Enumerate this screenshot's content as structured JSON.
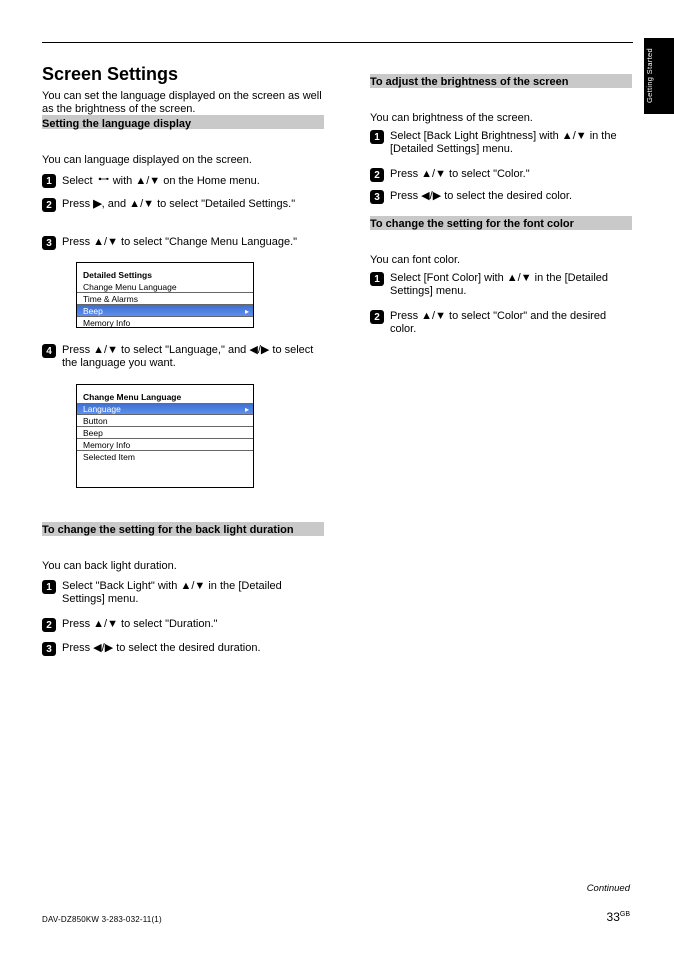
{
  "sidebar_label": "Getting Started",
  "h2_screen": "Screen Settings",
  "p_screen": "You can set the language displayed on the screen as well as the brightness of the screen.",
  "bar_lang": "Setting the language display",
  "p_lang": "You can language displayed on the screen.",
  "steps_lang": {
    "s1": {
      "pre": "Select ",
      "icon": "wrench",
      "post": " with ▲/▼ on the Home menu."
    },
    "s2": {
      "pre": "Press ",
      "b": "▶",
      "post": ", and ▲/▼ to select \"Detailed Settings.\""
    },
    "s3": "Press ▲/▼ to select \"Change Menu Language.\"",
    "s4": "Press ▲/▼ to select \"Language,\" and ◀/▶ to select the language you want."
  },
  "menu1": {
    "title": "Detailed Settings",
    "items": [
      "Change Menu Language",
      "Time & Alarms",
      "Beep",
      "Memory Info"
    ],
    "selected": 2
  },
  "menu2": {
    "title": "Change Menu Language",
    "items": [
      "Language",
      "Button",
      "Beep",
      "Memory Info",
      "Selected Item"
    ],
    "selected": 0
  },
  "bar_bkl": "To change the setting for the back light duration",
  "p_bkl": "You can back light duration.",
  "steps_bkl": {
    "s1": "Select \"Back Light\" with ▲/▼ in the [Detailed Settings] menu.",
    "s2": "Press ▲/▼ to select \"Duration.\"",
    "s3": "Press ◀/▶ to select the desired duration."
  },
  "bar_bright": "To adjust the brightness of the screen",
  "p_bright": "You can brightness of the screen.",
  "steps_bright": {
    "s1": "Select [Back Light Brightness] with ▲/▼ in the [Detailed Settings] menu.",
    "s2": "Press ▲/▼ to select \"Color.\"",
    "s3": "Press ◀/▶ to select the desired color."
  },
  "bar_color": "To change the setting for the font color",
  "p_color": "You can font color.",
  "steps_color": {
    "s1": "Select [Font Color] with ▲/▼ in the [Detailed Settings] menu.",
    "s2": "Press ▲/▼ to select \"Color\" and the desired color."
  },
  "cont": "Continued",
  "foot": "DAV-DZ850KW   3-283-032-11(1)",
  "pgnum": "33",
  "pgnum_label": "GB"
}
